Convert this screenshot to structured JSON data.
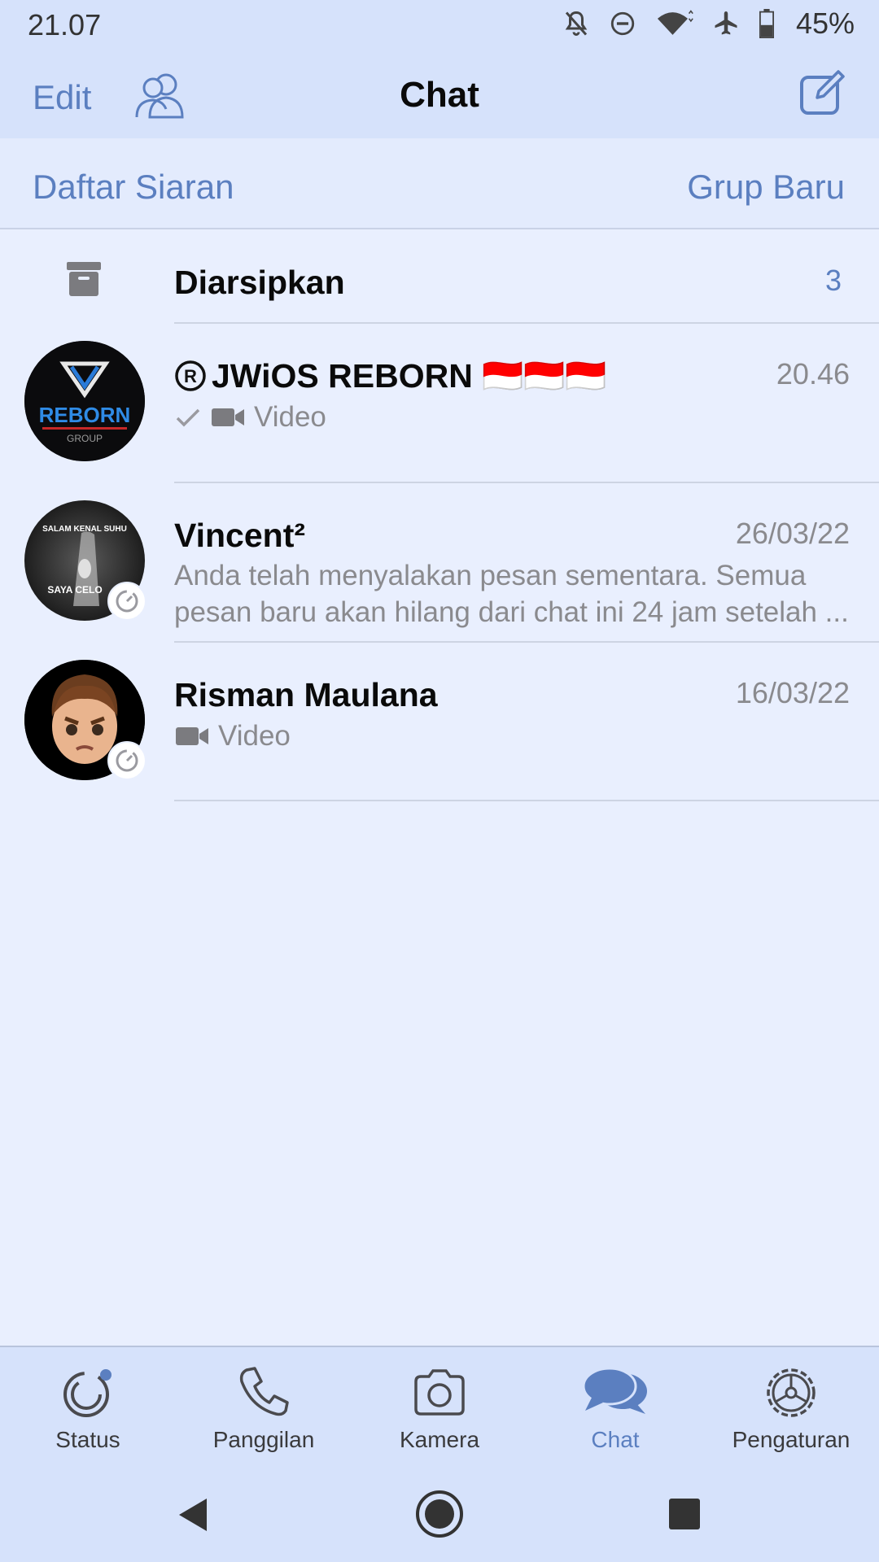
{
  "status_bar": {
    "time": "21.07",
    "battery": "45%"
  },
  "nav": {
    "edit_label": "Edit",
    "title": "Chat"
  },
  "actions": {
    "broadcast_label": "Daftar Siaran",
    "new_group_label": "Grup Baru"
  },
  "archived": {
    "label": "Diarsipkan",
    "count": "3"
  },
  "chats": [
    {
      "name": "JWiOS REBORN 🇮🇩🇮🇩🇮🇩",
      "time": "20.46",
      "preview": "Video",
      "avatar_text": [
        "REBORN",
        "GROUP"
      ]
    },
    {
      "name": "Vincent²",
      "time": "26/03/22",
      "preview": "Anda telah menyalakan pesan sementara. Semua pesan baru akan hilang dari chat ini 24 jam setelah ...",
      "avatar_text": [
        "SALAM KENAL SUHU",
        "SAYA CELO"
      ]
    },
    {
      "name": "Risman Maulana",
      "time": "16/03/22",
      "preview": "Video"
    }
  ],
  "tabs": [
    {
      "label": "Status",
      "icon": "status-icon"
    },
    {
      "label": "Panggilan",
      "icon": "phone-icon"
    },
    {
      "label": "Kamera",
      "icon": "camera-icon"
    },
    {
      "label": "Chat",
      "icon": "chat-bubbles-icon",
      "active": true
    },
    {
      "label": "Pengaturan",
      "icon": "gear-icon"
    }
  ],
  "colors": {
    "accent": "#5b7fc0",
    "header_bg": "#d6e2fb",
    "page_bg": "#e9effe",
    "secondary_text": "#8a8a8e"
  }
}
